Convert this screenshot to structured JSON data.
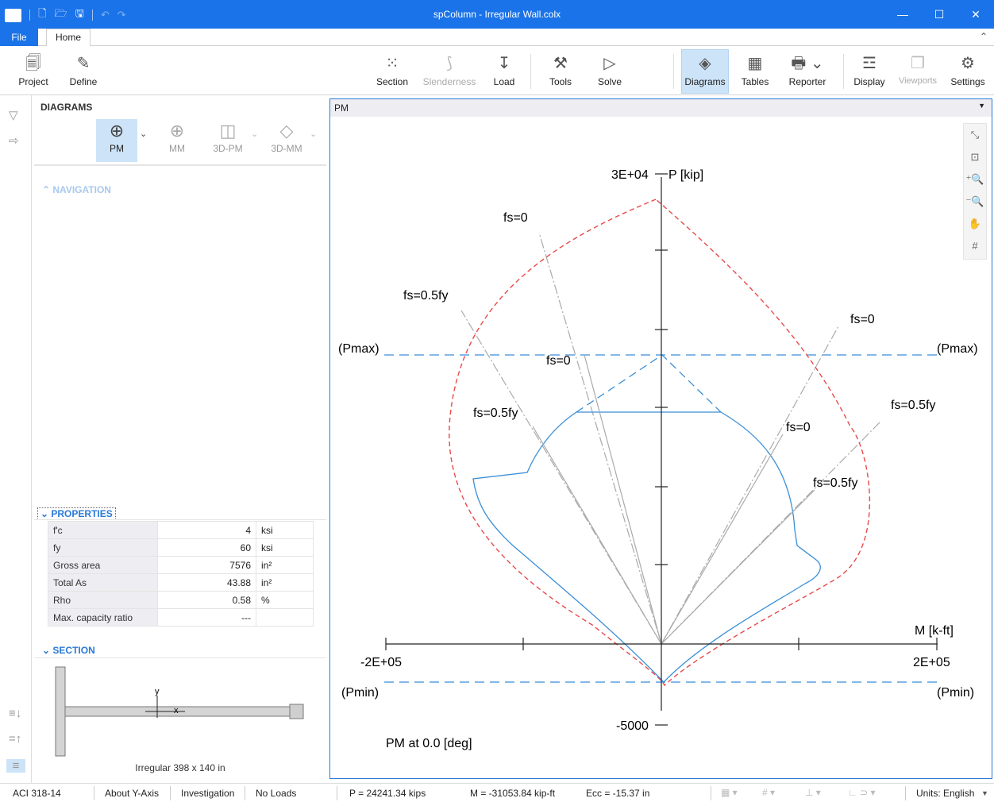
{
  "window": {
    "title": "spColumn - Irregular Wall.colx",
    "logo": "sp",
    "minimize": "—",
    "maximize": "☐",
    "close": "✕"
  },
  "ribbon_tabs": {
    "file": "File",
    "home": "Home"
  },
  "ribbon": {
    "project": "Project",
    "define": "Define",
    "section": "Section",
    "slenderness": "Slenderness",
    "load": "Load",
    "tools": "Tools",
    "solve": "Solve",
    "diagrams": "Diagrams",
    "tables": "Tables",
    "reporter": "Reporter",
    "display": "Display",
    "viewports": "Viewports",
    "settings": "Settings"
  },
  "left_panel": {
    "header": "DIAGRAMS",
    "diagram_types": [
      "PM",
      "MM",
      "3D-PM",
      "3D-MM"
    ],
    "navigation": "NAVIGATION",
    "properties_header": "PROPERTIES",
    "properties": [
      {
        "name": "f'c",
        "value": "4",
        "unit": "ksi"
      },
      {
        "name": "fy",
        "value": "60",
        "unit": "ksi"
      },
      {
        "name": "Gross area",
        "value": "7576",
        "unit": "in²"
      },
      {
        "name": "Total As",
        "value": "43.88",
        "unit": "in²"
      },
      {
        "name": "Rho",
        "value": "0.58",
        "unit": "%"
      },
      {
        "name": "Max. capacity ratio",
        "value": "---",
        "unit": ""
      }
    ],
    "section_header": "SECTION",
    "section_axis_y": "y",
    "section_axis_x": "x",
    "section_caption": "Irregular 398 x 140 in"
  },
  "diagram": {
    "tab_label": "PM",
    "y_axis_label": "P [kip]",
    "x_axis_label": "M [k-ft]",
    "y_max_label": "3E+04",
    "y_min_label": "-5000",
    "x_min_label": "-2E+05",
    "x_max_label": "2E+05",
    "pmax_label": "(Pmax)",
    "pmin_label": "(Pmin)",
    "footer_label": "PM at 0.0 [deg]",
    "line_labels": [
      {
        "text": "fs=0"
      },
      {
        "text": "fs=0.5fy"
      },
      {
        "text": "fs=0"
      },
      {
        "text": "fs=0.5fy"
      },
      {
        "text": "fs=0"
      },
      {
        "text": "fs=0.5fy"
      },
      {
        "text": "fs=0"
      },
      {
        "text": "fs=0.5fy"
      }
    ],
    "colors": {
      "design_curve": "#3a8fd8",
      "nominal_curve": "#e84a4a",
      "limit_lines": "#5a9fe0",
      "axis": "#222222",
      "strain_lines": "#a8a8a8"
    }
  },
  "status_bar": {
    "code": "ACI 318-14",
    "axis": "About Y-Axis",
    "mode": "Investigation",
    "loads": "No Loads",
    "p_readout": "P = 24241.34 kips",
    "m_readout": "M = -31053.84 kip-ft",
    "ecc_readout": "Ecc = -15.37 in",
    "units": "Units:  English"
  }
}
